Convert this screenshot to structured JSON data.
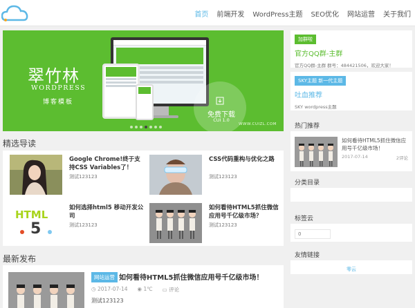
{
  "nav": {
    "items": [
      "首页",
      "前端开发",
      "WordPress主题",
      "SEO优化",
      "网站运营",
      "关于我们"
    ],
    "active_index": 0
  },
  "banner": {
    "title": "翠竹林",
    "wordpress": "WORDPRESS",
    "subtitle": "博客模板",
    "download": "免费下载",
    "version": "CUI 1.0",
    "url": "WWW.CUIZL.COM",
    "slide_count": 7,
    "active_slide": 3
  },
  "sections": {
    "featured": "精选导读",
    "latest": "最新发布"
  },
  "featured": [
    {
      "title": "Google Chrome!终于支持CSS Variables了！",
      "meta": "测试123123"
    },
    {
      "title": "CSS代码重构与优化之路",
      "meta": "测试123123"
    },
    {
      "title": "如何选择html5 移动开发公司",
      "meta": "测试123123"
    },
    {
      "title": "如何看待HTML5抓住微信应用号千亿级市场？",
      "meta": "测试123123"
    }
  ],
  "latest": {
    "badge": "网站运营",
    "title": "如何看待HTML5抓住微信应用号千亿级市场！",
    "date": "2017-07-14",
    "temp": "1℃",
    "comments": "评论",
    "excerpt": "测试123123"
  },
  "sidebar": {
    "qq": {
      "tag": "加群啦",
      "title": "官方QQ群-主群",
      "desc": "官方QQ群-主群 群号：484421506，欢迎大家！"
    },
    "sky": {
      "tag": "SKY主题 新一代主题",
      "title": "吐血推荐",
      "desc": "SKY wordpress主题"
    },
    "hot": {
      "heading": "热门推荐",
      "title": "如何看待HTML5抓住微信应用号千亿级市场！",
      "date": "2017-07-14",
      "comments": "2评论"
    },
    "categories": {
      "heading": "分类目录"
    },
    "tags": {
      "heading": "标签云",
      "value": "0"
    },
    "links": {
      "heading": "友情链接",
      "item": "零云"
    }
  },
  "colors": {
    "green": "#5cbd30",
    "blue": "#5cb8e6"
  },
  "icons": {
    "logo": "cloud-logo-icon",
    "download": "download-icon",
    "date": "clock-icon",
    "temp": "thermometer-icon",
    "comment": "comment-icon"
  }
}
